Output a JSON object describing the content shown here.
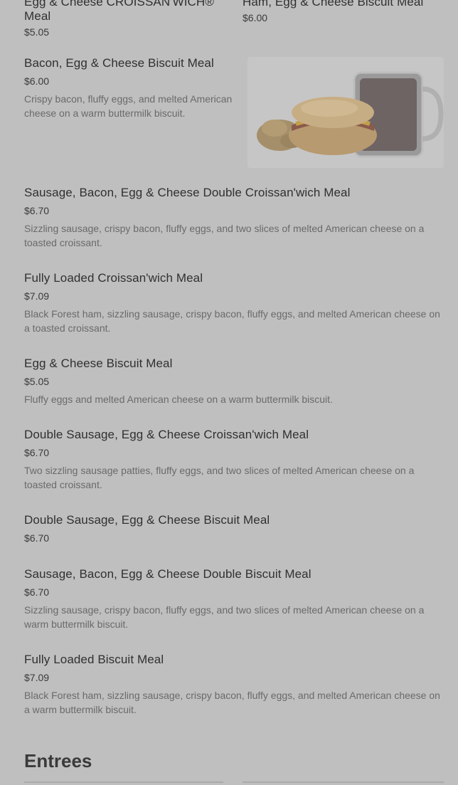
{
  "items": [
    {
      "name": "Egg & Cheese CROISSAN'WICH® Meal",
      "price": "$5.05",
      "desc": ""
    },
    {
      "name": "Ham, Egg & Cheese Biscuit Meal",
      "price": "$6.00",
      "desc": ""
    },
    {
      "name": "Bacon, Egg & Cheese Biscuit Meal",
      "price": "$6.00",
      "desc": "Crispy bacon, fluffy eggs, and melted American cheese on a warm buttermilk biscuit."
    },
    {
      "name": "Sausage, Bacon, Egg & Cheese Double Croissan'wich Meal",
      "price": "$6.70",
      "desc": "Sizzling sausage, crispy bacon, fluffy eggs, and two slices of melted American cheese on a toasted croissant."
    },
    {
      "name": "Fully Loaded Croissan'wich Meal",
      "price": "$7.09",
      "desc": "Black Forest ham, sizzling sausage, crispy bacon, fluffy eggs, and melted American cheese on a toasted croissant."
    },
    {
      "name": "Egg & Cheese Biscuit Meal",
      "price": "$5.05",
      "desc": "Fluffy eggs and melted American cheese on a warm buttermilk biscuit."
    },
    {
      "name": "Double Sausage, Egg & Cheese Croissan'wich Meal",
      "price": "$6.70",
      "desc": "Two sizzling sausage patties, fluffy eggs, and two slices of melted American cheese on a toasted croissant."
    },
    {
      "name": "Double Sausage, Egg & Cheese Biscuit Meal",
      "price": "$6.70",
      "desc": ""
    },
    {
      "name": "Sausage, Bacon, Egg & Cheese Double Biscuit Meal",
      "price": "$6.70",
      "desc": "Sizzling sausage, crispy bacon, fluffy eggs, and two slices of melted American cheese on a warm buttermilk biscuit."
    },
    {
      "name": "Fully Loaded Biscuit Meal",
      "price": "$7.09",
      "desc": "Black Forest ham, sizzling sausage, crispy bacon, fluffy eggs, and melted American cheese on a warm buttermilk biscuit."
    }
  ],
  "section": {
    "title": "Entrees"
  },
  "colors": {
    "overlay": "#bfbfbf",
    "name": "#303030",
    "desc": "#6a6a6a"
  },
  "image": {
    "icon": "breakfast-meal-photo"
  }
}
